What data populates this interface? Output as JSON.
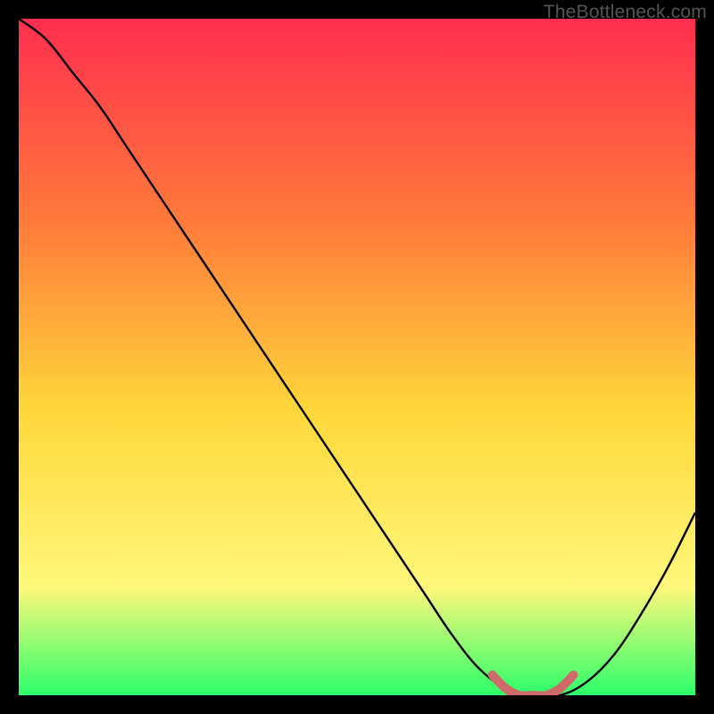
{
  "watermark": "TheBottleneck.com",
  "chart_data": {
    "type": "line",
    "title": "",
    "xlabel": "",
    "ylabel": "",
    "xlim": [
      0,
      100
    ],
    "ylim": [
      0,
      100
    ],
    "grid": false,
    "background_gradient": {
      "top": "#ff2e4f",
      "mid_upper": "#ff7a3a",
      "mid": "#ffd73a",
      "mid_lower": "#fff77a",
      "bottom": "#2cff6a"
    },
    "series": [
      {
        "name": "bottleneck-curve",
        "stroke": "#000000",
        "x": [
          0,
          4,
          8,
          12,
          16,
          20,
          24,
          28,
          32,
          36,
          40,
          44,
          48,
          52,
          56,
          60,
          64,
          68,
          72,
          76,
          80,
          84,
          88,
          92,
          96,
          100
        ],
        "values": [
          100,
          97,
          92,
          87,
          81,
          75,
          69,
          63,
          57,
          51,
          45,
          39,
          33,
          27,
          21,
          15,
          9,
          4,
          1,
          0,
          0,
          2,
          6,
          12,
          19,
          27
        ]
      },
      {
        "name": "highlight-band",
        "stroke": "#cf6a6a",
        "x": [
          70,
          72,
          74,
          76,
          78,
          80,
          82
        ],
        "values": [
          3,
          1,
          0,
          0,
          0,
          1,
          3
        ]
      }
    ],
    "highlight_range_x": [
      70,
      82
    ],
    "notes": "V-shaped curve over a vertical red→orange→yellow→green gradient, with a short pink highlighted segment near the trough."
  }
}
